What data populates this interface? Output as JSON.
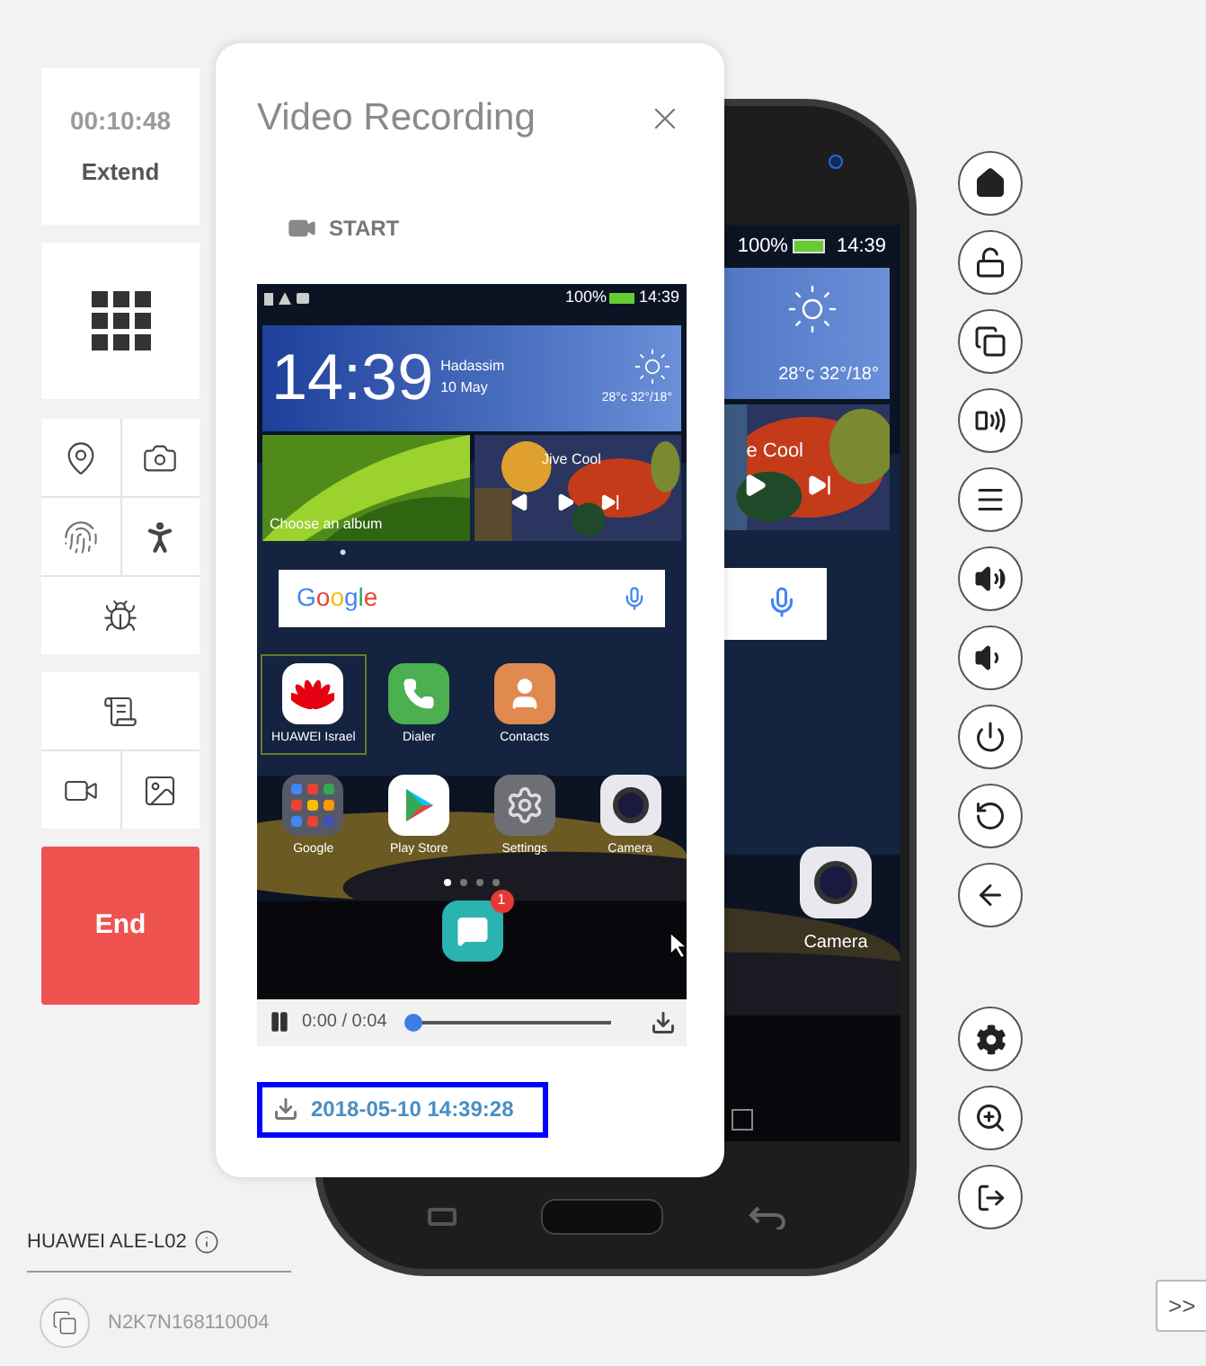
{
  "timer": {
    "time": "00:10:48",
    "action": "Extend"
  },
  "end_button": {
    "label": "End"
  },
  "dialog": {
    "title": "Video Recording",
    "start_label": "START",
    "screen": {
      "battery": "100%",
      "status_time": "14:39",
      "clock": "14:39",
      "location": "Hadassim",
      "date": "10 May",
      "weather": "28°c 32°/18°",
      "album_label": "Choose an album",
      "track": "Jive Cool",
      "search_logo": "Google",
      "app_rows": [
        [
          {
            "kind": "huawei",
            "label": "HUAWEI Israel",
            "selected": true
          },
          {
            "kind": "dialer",
            "label": "Dialer",
            "selected": false
          },
          {
            "kind": "contacts",
            "label": "Contacts",
            "selected": false
          }
        ],
        [
          {
            "kind": "folder",
            "label": "Google",
            "selected": false
          },
          {
            "kind": "play",
            "label": "Play Store",
            "selected": false
          },
          {
            "kind": "settings",
            "label": "Settings",
            "selected": false
          },
          {
            "kind": "camera",
            "label": "Camera",
            "selected": false
          }
        ]
      ],
      "page_dots": [
        {
          "selected": true
        },
        {
          "selected": false
        },
        {
          "selected": false
        },
        {
          "selected": false
        }
      ],
      "badge": "1"
    },
    "player": {
      "time": "0:00 / 0:04",
      "level": 0
    },
    "recording_link": "2018-05-10 14:39:28"
  },
  "device_screen": {
    "battery": "100%",
    "time": "14:39",
    "weather": "28°c 32°/18°",
    "track": "e Cool",
    "app_label": "Camera"
  },
  "device_model": "HUAWEI ALE-L02",
  "serial": "N2K7N168110004",
  "expand_label": ">>"
}
